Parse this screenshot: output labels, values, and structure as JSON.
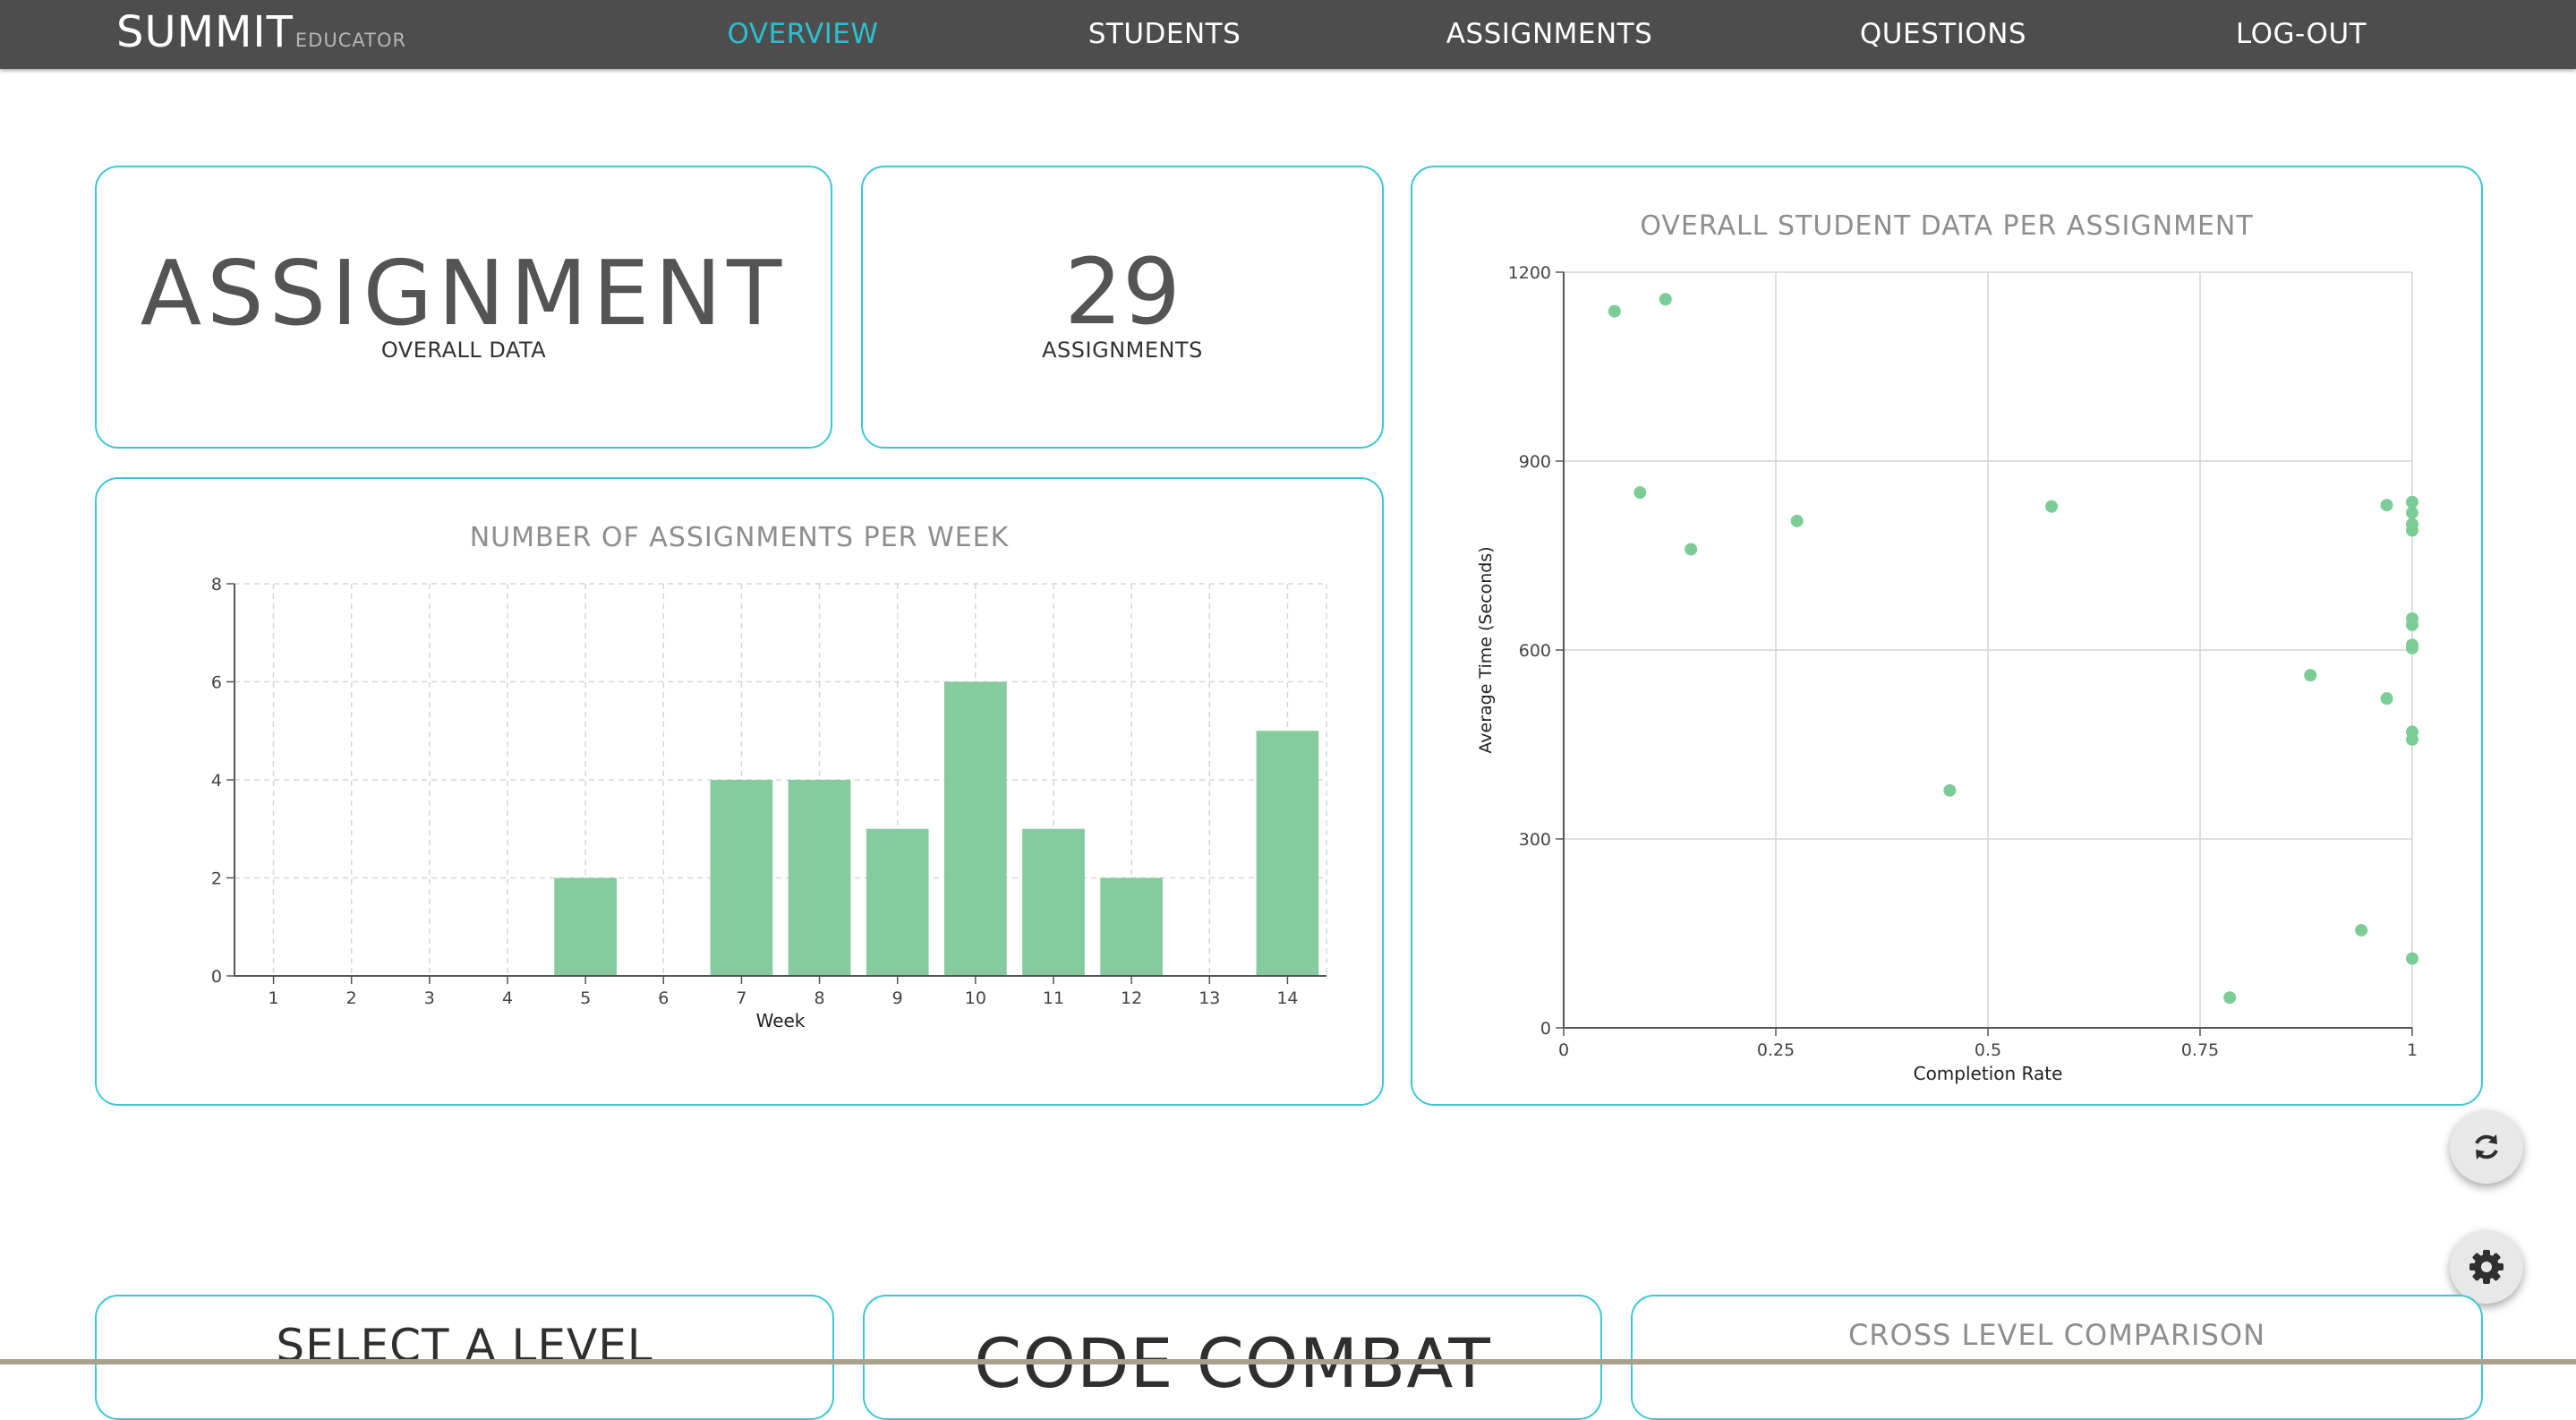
{
  "brand": {
    "name": "SUMMIT",
    "sub": "EDUCATOR"
  },
  "nav": {
    "items": [
      {
        "label": "OVERVIEW",
        "active": true
      },
      {
        "label": "STUDENTS",
        "active": false
      },
      {
        "label": "ASSIGNMENTS",
        "active": false
      },
      {
        "label": "QUESTIONS",
        "active": false
      },
      {
        "label": "LOG-OUT",
        "active": false
      }
    ],
    "active_color": "#2bbfcf"
  },
  "cards": {
    "assignment": {
      "title": "ASSIGNMENT",
      "subtitle": "OVERALL DATA"
    },
    "count": {
      "value": "29",
      "label": "ASSIGNMENTS"
    }
  },
  "chart_data": [
    {
      "type": "bar",
      "title": "NUMBER OF ASSIGNMENTS PER WEEK",
      "xlabel": "Week",
      "ylabel": "",
      "categories": [
        "1",
        "2",
        "3",
        "4",
        "5",
        "6",
        "7",
        "8",
        "9",
        "10",
        "11",
        "12",
        "13",
        "14"
      ],
      "values": [
        0,
        0,
        0,
        0,
        2,
        0,
        4,
        4,
        3,
        6,
        3,
        2,
        0,
        5
      ],
      "ylim": [
        0,
        8
      ],
      "yticks": [
        0,
        2,
        4,
        6,
        8
      ],
      "grid": "dashed",
      "color": "#86cb9e"
    },
    {
      "type": "scatter",
      "title": "OVERALL STUDENT DATA PER ASSIGNMENT",
      "xlabel": "Completion Rate",
      "ylabel": "Average Time (Seconds)",
      "xlim": [
        0,
        1
      ],
      "ylim": [
        0,
        1200
      ],
      "xticks": [
        0,
        0.25,
        0.5,
        0.75,
        1
      ],
      "yticks": [
        0,
        300,
        600,
        900,
        1200
      ],
      "grid": true,
      "color": "#7ccc97",
      "points": [
        {
          "x": 0.06,
          "y": 1138
        },
        {
          "x": 0.12,
          "y": 1157
        },
        {
          "x": 0.09,
          "y": 850
        },
        {
          "x": 0.15,
          "y": 760
        },
        {
          "x": 0.275,
          "y": 805
        },
        {
          "x": 0.575,
          "y": 828
        },
        {
          "x": 0.455,
          "y": 377
        },
        {
          "x": 0.785,
          "y": 48
        },
        {
          "x": 0.88,
          "y": 560
        },
        {
          "x": 0.94,
          "y": 155
        },
        {
          "x": 0.97,
          "y": 830
        },
        {
          "x": 0.97,
          "y": 523
        },
        {
          "x": 1.0,
          "y": 835
        },
        {
          "x": 1.0,
          "y": 818
        },
        {
          "x": 1.0,
          "y": 800
        },
        {
          "x": 1.0,
          "y": 790
        },
        {
          "x": 1.0,
          "y": 650
        },
        {
          "x": 1.0,
          "y": 640
        },
        {
          "x": 1.0,
          "y": 608
        },
        {
          "x": 1.0,
          "y": 603
        },
        {
          "x": 1.0,
          "y": 470
        },
        {
          "x": 1.0,
          "y": 458
        },
        {
          "x": 1.0,
          "y": 110
        }
      ]
    }
  ],
  "bottom_cards": {
    "level": {
      "title": "SELECT A LEVEL"
    },
    "game": {
      "title": "CODE COMBAT"
    },
    "compare": {
      "title": "CROSS LEVEL COMPARISON"
    }
  },
  "fabs": {
    "refresh_icon": "refresh-icon",
    "settings_icon": "gear-icon"
  },
  "colors": {
    "accent": "#3cc7d3",
    "nav_bg": "#4d4d4d",
    "bar": "#86cb9e",
    "point": "#7ccc97"
  }
}
